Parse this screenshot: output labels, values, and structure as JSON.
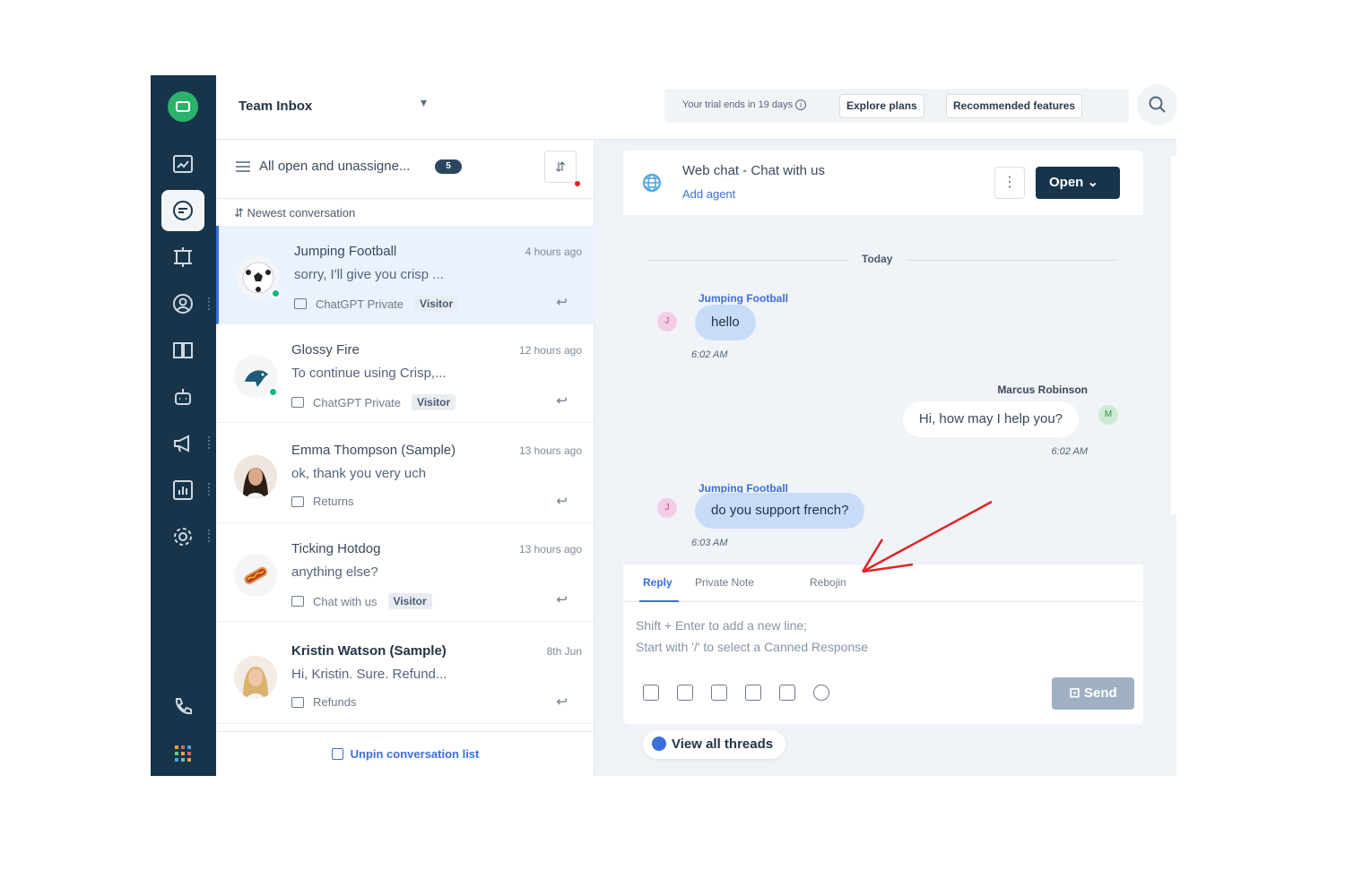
{
  "header": {
    "title": "Team Inbox",
    "caret": "▾",
    "trial_text": "Your trial ends in 19 days",
    "info_icon": "i",
    "explore_plans": "Explore plans",
    "recommended_features": "Recommended features"
  },
  "filter": {
    "label": "All open and unassigne...",
    "count": "5",
    "sort_label": "Newest conversation",
    "sort_icon": "⇵"
  },
  "conversations": [
    {
      "name": "Jumping Football",
      "time": "4 hours ago",
      "preview": "sorry, I'll give you crisp ...",
      "channel": "ChatGPT Private",
      "tag": "Visitor",
      "online": true,
      "selected": true
    },
    {
      "name": "Glossy Fire",
      "time": "12 hours ago",
      "preview": "To continue using Crisp,...",
      "channel": "ChatGPT Private",
      "tag": "Visitor",
      "online": true,
      "selected": false
    },
    {
      "name": "Emma Thompson (Sample)",
      "time": "13 hours ago",
      "preview": "ok, thank you very uch",
      "channel": "Returns",
      "tag": "",
      "online": false,
      "selected": false
    },
    {
      "name": "Ticking Hotdog",
      "time": "13 hours ago",
      "preview": "anything else?",
      "channel": "Chat with us",
      "tag": "Visitor",
      "online": false,
      "selected": false
    },
    {
      "name": "Kristin Watson (Sample)",
      "time": "8th Jun",
      "preview": "Hi, Kristin. Sure. Refund...",
      "channel": "Refunds",
      "tag": "",
      "online": false,
      "selected": false
    }
  ],
  "unpin_label": "Unpin conversation list",
  "chat": {
    "title": "Web chat - Chat with us",
    "add_agent": "Add agent",
    "more": "⋮",
    "status_button": "Open",
    "day_label": "Today",
    "messages": [
      {
        "sender": "Jumping Football",
        "text": "hello",
        "time": "6:02 AM",
        "avatar": "J",
        "direction": "in"
      },
      {
        "sender": "Marcus Robinson",
        "text": "Hi, how may I help you?",
        "time": "6:02 AM",
        "avatar": "M",
        "direction": "out"
      },
      {
        "sender": "Jumping Football",
        "text": "do you support french?",
        "time": "6:03 AM",
        "avatar": "J",
        "direction": "in"
      }
    ]
  },
  "composer": {
    "tabs": [
      "Reply",
      "Private Note",
      "Rebojin"
    ],
    "placeholder_line1": "Shift + Enter to add a new line;",
    "placeholder_line2": "Start with '/' to select a Canned Response",
    "send_label": "Send"
  },
  "view_all_threads": "View all threads",
  "colors": {
    "nav_bg": "#17344a",
    "accent": "#3b6fd8",
    "online": "#18b57a",
    "incoming_bubble": "#c7dcf7",
    "logo": "#2bb36b",
    "annotation_arrow": "#e02424"
  }
}
